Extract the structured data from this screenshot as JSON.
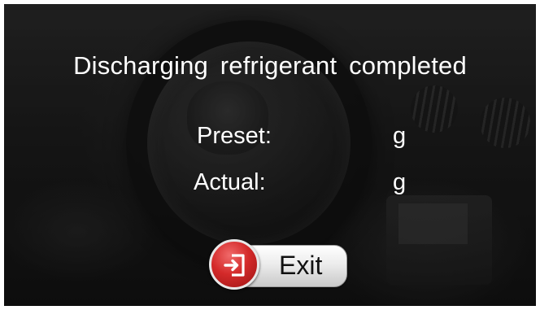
{
  "dialog": {
    "title": "Discharging  refrigerant  completed",
    "preset": {
      "label": "Preset:",
      "value": "",
      "unit": "g"
    },
    "actual": {
      "label": "Actual:",
      "value": "",
      "unit": "g"
    }
  },
  "exit_button": {
    "label": "Exit",
    "icon": "exit-door-icon"
  },
  "colors": {
    "text": "#ffffff",
    "exit_circle": "#d42a2a",
    "background": "#141414"
  }
}
